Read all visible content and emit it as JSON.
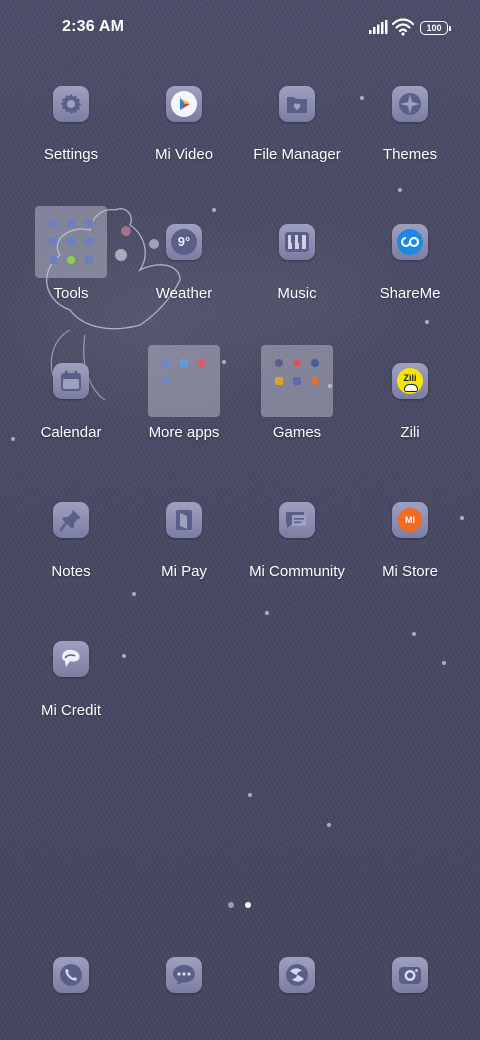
{
  "status_bar": {
    "time": "2:36 AM",
    "battery": "100"
  },
  "apps": [
    {
      "label": "Settings",
      "icon": "gear-icon"
    },
    {
      "label": "Mi Video",
      "icon": "play-icon"
    },
    {
      "label": "File Manager",
      "icon": "folder-icon"
    },
    {
      "label": "Themes",
      "icon": "themes-icon"
    },
    {
      "label": "Tools",
      "icon": "folder-icon"
    },
    {
      "label": "Weather",
      "icon": "weather-icon",
      "temp": "9°"
    },
    {
      "label": "Music",
      "icon": "piano-icon"
    },
    {
      "label": "ShareMe",
      "icon": "share-icon"
    },
    {
      "label": "Calendar",
      "icon": "calendar-icon"
    },
    {
      "label": "More apps",
      "icon": "folder-icon"
    },
    {
      "label": "Games",
      "icon": "folder-icon"
    },
    {
      "label": "Zili",
      "icon": "zili-icon",
      "badge": "Zili"
    },
    {
      "label": "Notes",
      "icon": "pin-icon"
    },
    {
      "label": "Mi Pay",
      "icon": "wallet-icon"
    },
    {
      "label": "Mi Community",
      "icon": "chat-icon"
    },
    {
      "label": "Mi Store",
      "icon": "mi-store-icon",
      "badge": "MI"
    },
    {
      "label": "Mi Credit",
      "icon": "credit-icon"
    }
  ],
  "dock": [
    {
      "icon": "phone-icon"
    },
    {
      "icon": "messages-icon"
    },
    {
      "icon": "browser-icon"
    },
    {
      "icon": "camera-icon"
    }
  ],
  "page_indicator": {
    "pages": 2,
    "current": 2
  },
  "colors": {
    "background": "#4a4b66",
    "icon_tile": "#8f92b4",
    "glyph": "#5b5e86",
    "mi_orange": "#f26a1b",
    "zili_yellow": "#f5e500",
    "shareme_blue": "#1e88e5"
  }
}
